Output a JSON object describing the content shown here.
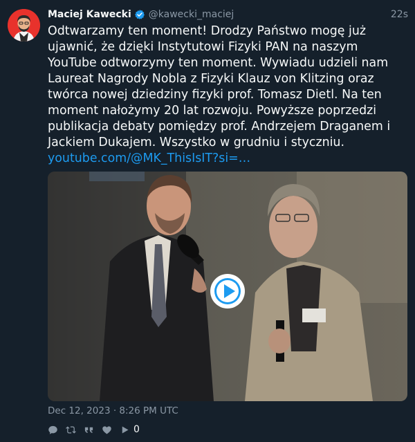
{
  "tweet": {
    "author": "Maciej Kawecki",
    "handle": "@kawecki_maciej",
    "time": "22s",
    "text": "Odtwarzamy ten moment! Drodzy Państwo mogę już ujawnić, że dzięki Instytutowi Fizyki PAN na naszym YouTube odtworzymy ten moment. Wywiadu udzieli nam Laureat Nagrody Nobla z Fizyki Klauz von Klitzing oraz twórca nowej dziedziny fizyki prof. Tomasz Dietl. Na ten moment nałożymy 20 lat rozwoju. Powyższe poprzedzi publikacja debaty pomiędzy prof. Andrzejem Draganem i Jackiem Dukajem. Wszystko w grudniu i styczniu. ",
    "link": "youtube.com/@MK_ThisIsIT?si=…",
    "date": "Dec 12, 2023 · 8:26 PM UTC",
    "like_count": "0"
  },
  "icons": {
    "verified": "verified-badge-icon",
    "reply": "reply-icon",
    "retweet": "retweet-icon",
    "quote": "quote-icon",
    "like": "heart-icon",
    "play": "play-icon"
  },
  "colors": {
    "background": "#15202b",
    "text": "#f7f9f9",
    "muted": "#8b98a5",
    "link": "#1d9bf0"
  }
}
